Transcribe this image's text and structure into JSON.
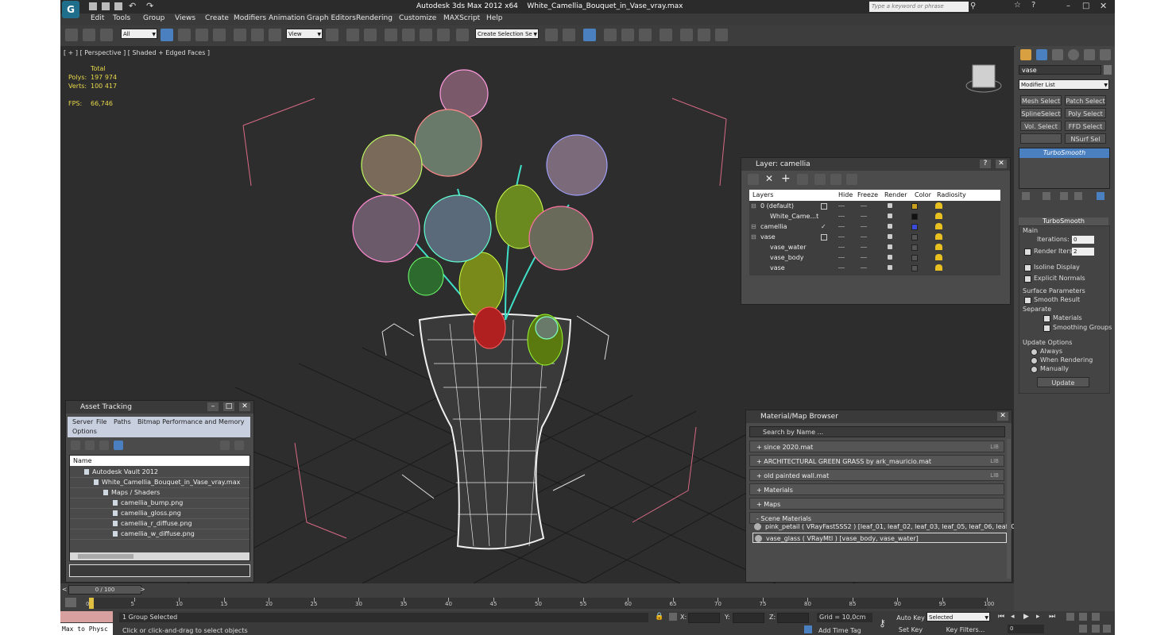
{
  "titlebar": {
    "app": "Autodesk 3ds Max  2012 x64",
    "file": "White_Camellia_Bouquet_in_Vase_vray.max",
    "search_placeholder": "Type a keyword or phrase"
  },
  "menu": [
    "Edit",
    "Tools",
    "Group",
    "Views",
    "Create",
    "Modifiers",
    "Animation",
    "Graph Editors",
    "Rendering",
    "Customize",
    "MAXScript",
    "Help"
  ],
  "toolbar": {
    "filter": "All",
    "refcoord": "View",
    "selection_set": "Create Selection Se",
    "snap_label": "3"
  },
  "viewport": {
    "label": "[ + ] [ Perspective ] [ Shaded + Edged Faces ]",
    "stats": {
      "total": "Total",
      "polys_label": "Polys:",
      "polys": "197 974",
      "verts_label": "Verts:",
      "verts": "100 417",
      "fps_label": "FPS:",
      "fps": "66,746"
    }
  },
  "layer_window": {
    "title": "Layer: camellia",
    "columns": [
      "Layers",
      "Hide",
      "Freeze",
      "Render",
      "Color",
      "Radiosity"
    ],
    "rows": [
      {
        "name": "0 (default)",
        "indent": 0,
        "color": "#c8a020",
        "current": false
      },
      {
        "name": "White_Came...t",
        "indent": 1,
        "color": "#111111",
        "current": false
      },
      {
        "name": "camellia",
        "indent": 0,
        "color": "#3a4bd8",
        "current": true
      },
      {
        "name": "vase",
        "indent": 0,
        "color": "#555555",
        "current": false
      },
      {
        "name": "vase_water",
        "indent": 1,
        "color": "#555555",
        "current": false
      },
      {
        "name": "vase_body",
        "indent": 1,
        "color": "#555555",
        "current": false
      },
      {
        "name": "vase",
        "indent": 1,
        "color": "#555555",
        "current": false
      }
    ]
  },
  "asset_tracking": {
    "title": "Asset Tracking",
    "menu": [
      "Server",
      "File",
      "Paths",
      "Bitmap Performance and Memory"
    ],
    "menu2": "Options",
    "column": "Name",
    "items": [
      {
        "name": "Autodesk Vault 2012",
        "indent": 0
      },
      {
        "name": "White_Camellia_Bouquet_in_Vase_vray.max",
        "indent": 1
      },
      {
        "name": "Maps / Shaders",
        "indent": 2
      },
      {
        "name": "camellia_bump.png",
        "indent": 3
      },
      {
        "name": "camellia_gloss.png",
        "indent": 3
      },
      {
        "name": "camellia_r_diffuse.png",
        "indent": 3
      },
      {
        "name": "camellia_w_diffuse.png",
        "indent": 3
      }
    ]
  },
  "material_browser": {
    "title": "Material/Map Browser",
    "search": "Search by Name ...",
    "groups": [
      {
        "label": "+ since 2020.mat",
        "lib": "LIB"
      },
      {
        "label": "+ ARCHITECTURAL GREEN GRASS by ark_mauricio.mat",
        "lib": "LIB"
      },
      {
        "label": "+ old painted wall.mat",
        "lib": "LIB"
      },
      {
        "label": "+ Materials",
        "lib": ""
      },
      {
        "label": "+ Maps",
        "lib": ""
      },
      {
        "label": "- Scene Materials",
        "lib": ""
      }
    ],
    "scene_materials": [
      "pink_petail  ( VRayFastSSS2 )  [leaf_01, leaf_02, leaf_03, leaf_05, leaf_06, leaf_0...",
      "vase_glass  ( VRayMtl ) [vase_body, vase_water]"
    ]
  },
  "command_panel": {
    "object_name": "vase",
    "modifier_list": "Modifier List",
    "mod_buttons": [
      "Mesh Select",
      "Patch Select",
      "SplineSelect",
      "Poly Select",
      "Vol. Select",
      "FFD Select",
      "",
      "NSurf Sel"
    ],
    "stack_item": "TurboSmooth",
    "rollout": "TurboSmooth",
    "main": "Main",
    "iterations_label": "Iterations:",
    "iterations": "0",
    "render_iters_label": "Render Iters:",
    "render_iters": "2",
    "isoline": "Isoline Display",
    "explicit": "Explicit Normals",
    "surface_params": "Surface Parameters",
    "smooth_result": "Smooth Result",
    "separate": "Separate",
    "materials": "Materials",
    "smoothing_groups": "Smoothing Groups",
    "update_options": "Update Options",
    "always": "Always",
    "when_rendering": "When Rendering",
    "manually": "Manually",
    "update": "Update"
  },
  "timeline": {
    "frame": "0 / 100",
    "ticks": [
      "0",
      "5",
      "10",
      "15",
      "20",
      "25",
      "30",
      "35",
      "40",
      "45",
      "50",
      "55",
      "60",
      "65",
      "70",
      "75",
      "80",
      "85",
      "90",
      "95",
      "100"
    ]
  },
  "statusbar": {
    "maxscript": "Max to Physc",
    "selected": "1 Group Selected",
    "prompt": "Click or click-and-drag to select objects",
    "x": "X:",
    "y": "Y:",
    "z": "Z:",
    "grid": "Grid = 10,0cm",
    "add_time_tag": "Add Time Tag",
    "auto_key": "Auto Key",
    "selected_dd": "Selected",
    "set_key": "Set Key",
    "key_filters": "Key Filters...",
    "frame_field": "0"
  }
}
